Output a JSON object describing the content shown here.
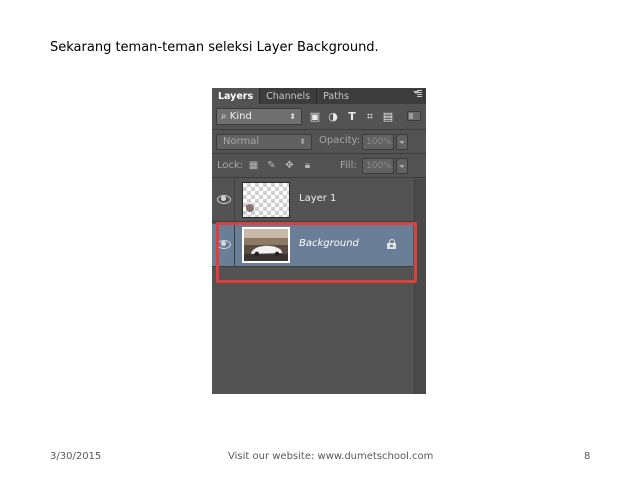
{
  "slide": {
    "title": "Sekarang teman-teman seleksi Layer Background."
  },
  "footer": {
    "date": "3/30/2015",
    "website": "Visit our website: www.dumetschool.com",
    "page_number": "8"
  },
  "layers_panel": {
    "tabs": [
      {
        "label": "Layers",
        "active": true
      },
      {
        "label": "Channels",
        "active": false
      },
      {
        "label": "Paths",
        "active": false
      }
    ],
    "menu_icon": "panel-menu-icon",
    "filter": {
      "kind_label": "Kind",
      "kind_icon": "search-icon",
      "kind_chevron": "⬍",
      "filter_icons": [
        "image-filter-icon",
        "adjustment-filter-icon",
        "type-filter-icon",
        "shape-filter-icon",
        "smart-object-filter-icon"
      ]
    },
    "blend": {
      "mode": "Normal",
      "opacity_label": "Opacity:",
      "opacity_value": "100%"
    },
    "lock": {
      "label": "Lock:",
      "lock_icons": [
        "lock-transparent-pixels-icon",
        "lock-image-pixels-icon",
        "lock-position-icon",
        "lock-all-icon"
      ],
      "fill_label": "Fill:",
      "fill_value": "100%"
    },
    "layers": [
      {
        "name": "Layer 1",
        "visible": true,
        "selected": false,
        "thumbnail": "transparent-checker"
      },
      {
        "name": "Background",
        "visible": true,
        "selected": true,
        "locked": true,
        "thumbnail": "car-photo"
      }
    ],
    "highlight_color": "#d9403e",
    "selection_color": "#6a7f97"
  }
}
